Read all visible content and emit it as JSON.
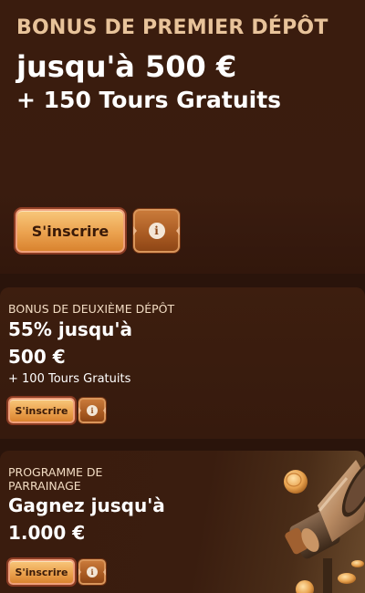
{
  "promos": [
    {
      "title": "BONUS DE PREMIER DÉPÔT",
      "amount": "jusqu'à 500 €",
      "extra": "+ 150 Tours Gratuits",
      "button_label": "S'inscrire",
      "info_label": "i"
    },
    {
      "title": "BONUS DE DEUXIÈME DÉPÔT",
      "amount_line1": "55% jusqu'à",
      "amount_line2": "500 €",
      "extra": "+ 100 Tours Gratuits",
      "button_label": "S'inscrire",
      "info_label": "i"
    },
    {
      "title_line1": "PROGRAMME DE",
      "title_line2": "PARRAINAGE",
      "amount_line1": "Gagnez jusqu'à",
      "amount_line2": "1.000 €",
      "button_label": "S'inscrire",
      "info_label": "i",
      "image_icon": "megaphone-coins-icon"
    }
  ],
  "colors": {
    "background": "#2a140b",
    "card": "#3a1c0e",
    "title_accent": "#e8c39a",
    "button_gold": "#eba24f",
    "button_info": "#a85a22"
  }
}
